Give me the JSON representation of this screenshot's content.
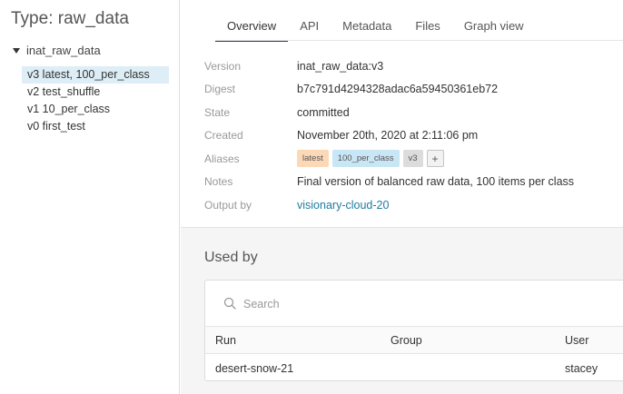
{
  "sidebar": {
    "title": "Type: raw_data",
    "collection": "inat_raw_data",
    "versions": [
      {
        "label": "v3 latest, 100_per_class",
        "selected": true
      },
      {
        "label": "v2 test_shuffle",
        "selected": false
      },
      {
        "label": "v1 10_per_class",
        "selected": false
      },
      {
        "label": "v0 first_test",
        "selected": false
      }
    ]
  },
  "tabs": [
    {
      "label": "Overview",
      "active": true
    },
    {
      "label": "API",
      "active": false
    },
    {
      "label": "Metadata",
      "active": false
    },
    {
      "label": "Files",
      "active": false
    },
    {
      "label": "Graph view",
      "active": false
    }
  ],
  "overview": {
    "version": {
      "label": "Version",
      "value": "inat_raw_data:v3"
    },
    "digest": {
      "label": "Digest",
      "value": "b7c791d4294328adac6a59450361eb72"
    },
    "state": {
      "label": "State",
      "value": "committed"
    },
    "created": {
      "label": "Created",
      "value": "November 20th, 2020 at 2:11:06 pm"
    },
    "aliases": {
      "label": "Aliases",
      "items": [
        "latest",
        "100_per_class",
        "v3"
      ],
      "add": "+"
    },
    "notes": {
      "label": "Notes",
      "value": "Final version of balanced raw data, 100 items per class"
    },
    "output_by": {
      "label": "Output by",
      "value": "visionary-cloud-20"
    }
  },
  "used_by": {
    "title": "Used by",
    "search_placeholder": "Search",
    "columns": [
      "Run",
      "Group",
      "User"
    ],
    "rows": [
      {
        "run": "desert-snow-21",
        "group": "",
        "user": "stacey"
      }
    ]
  },
  "colors": {
    "link": "#1f7ba1",
    "selected_bg": "#ddeef6",
    "alias_latest": "#fbd9b6",
    "alias_class": "#c9e6f5",
    "alias_version": "#dcdcdc"
  }
}
